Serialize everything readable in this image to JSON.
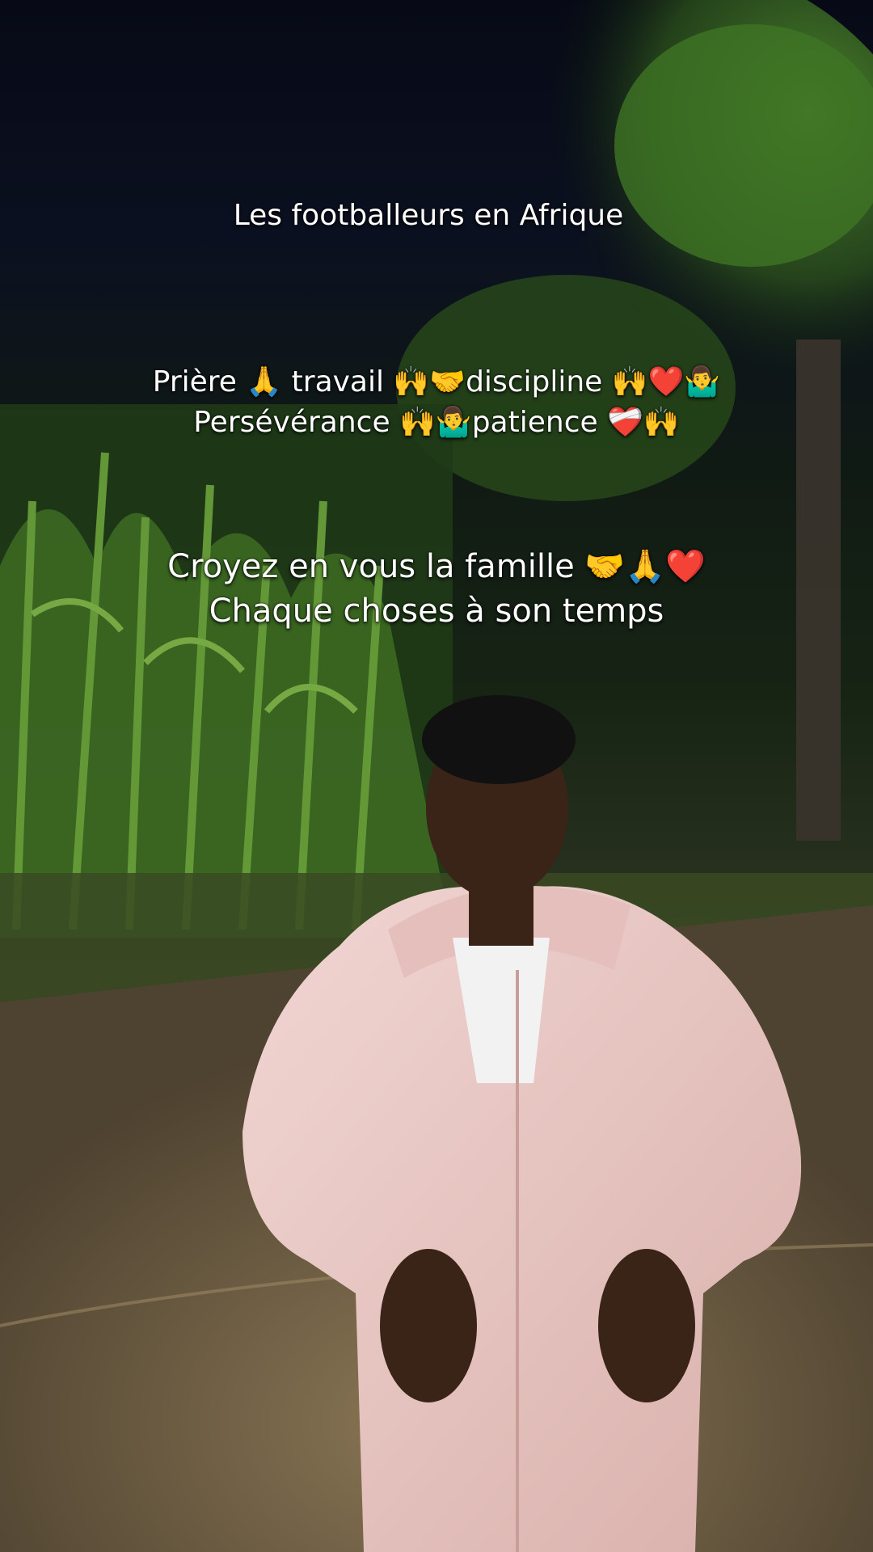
{
  "overlay": {
    "title": "Les footballeurs en Afrique",
    "lines_1": [
      "Prière 🙏 travail 🙌🤝discipline 🙌❤️🤷‍♂️",
      "Persévérance 🙌🤷‍♂️patience ❤️‍🩹🙌"
    ],
    "lines_2": [
      "Croyez en vous la famille 🤝🙏❤️",
      "Chaque choses à son temps"
    ]
  },
  "colors": {
    "night_sky": "#070a16",
    "foliage": "#2f5a1e",
    "ground": "#77644a",
    "jacket": "#e9c9c6",
    "shirt": "#f2f2f2",
    "skin": "#3a2418"
  }
}
